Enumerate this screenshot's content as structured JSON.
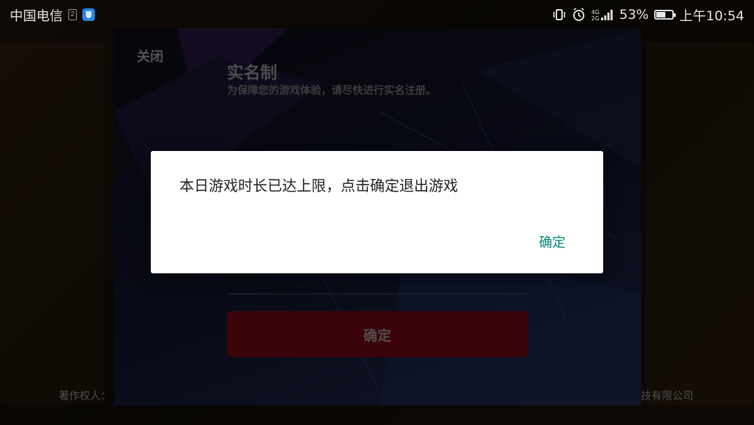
{
  "status_bar": {
    "carrier": "中国电信",
    "sim_slot": "2",
    "vpn_icon": "shield-icon",
    "vibrate_icon": "vibrate-icon",
    "alarm_icon": "alarm-icon",
    "network": "4G/2G",
    "battery_percent": "53%",
    "battery_level": 0.53,
    "time": "上午10:54"
  },
  "panel": {
    "close_label": "关闭",
    "title": "实名制",
    "subtitle": "为保障您的游戏体验，请尽快进行实名注册。",
    "confirm_label": "确定"
  },
  "footer": {
    "left_text": "著作权人：",
    "right_text": "技有限公司"
  },
  "dialog": {
    "message": "本日游戏时长已达上限，点击确定退出游戏",
    "ok_label": "确定"
  },
  "colors": {
    "dialog_accent": "#008577",
    "panel_button": "#6b0813"
  }
}
